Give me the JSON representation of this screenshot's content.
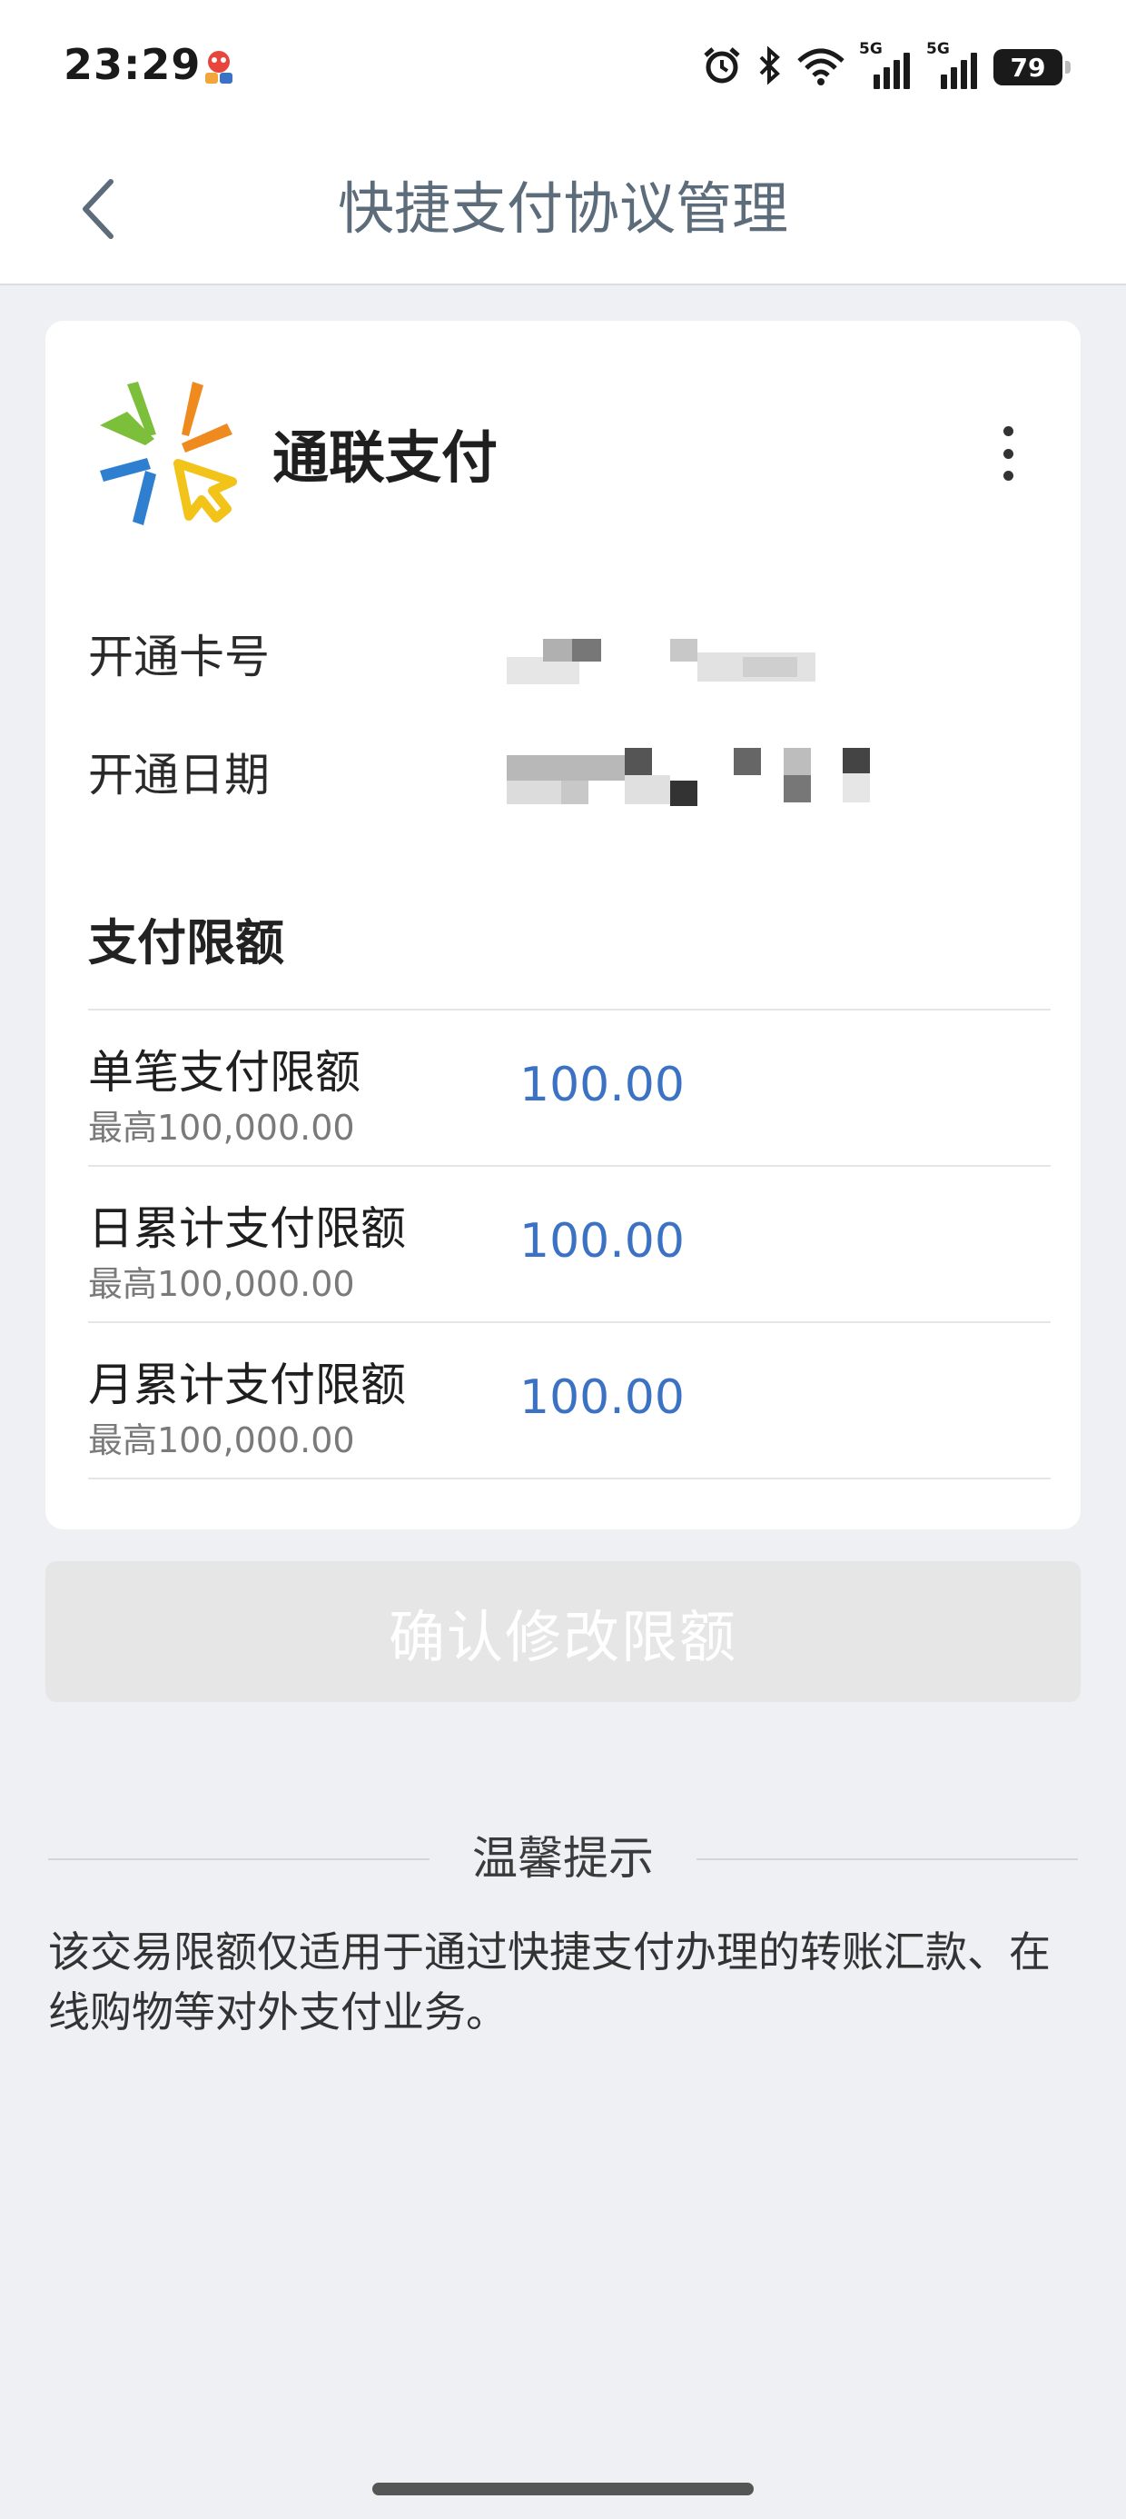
{
  "status_bar": {
    "time": "23:29",
    "network_label_1": "5G",
    "network_label_2": "5G",
    "battery": "79"
  },
  "nav": {
    "title": "快捷支付协议管理",
    "back_icon": "chevron-left-icon"
  },
  "merchant": {
    "name": "通联支付",
    "logo_icon": "allinpay-logo",
    "more_icon": "more-vertical-icon"
  },
  "info": {
    "card_label": "开通卡号",
    "date_label": "开通日期"
  },
  "limits": {
    "section_title": "支付限额",
    "rows": [
      {
        "label": "单笔支付限额",
        "hint": "最高100,000.00",
        "value": "100.00"
      },
      {
        "label": "日累计支付限额",
        "hint": "最高100,000.00",
        "value": "100.00"
      },
      {
        "label": "月累计支付限额",
        "hint": "最高100,000.00",
        "value": "100.00"
      }
    ]
  },
  "confirm_button": "确认修改限额",
  "tips": {
    "title": "温馨提示",
    "body": "该交易限额仅适用于通过快捷支付办理的转账汇款、在线购物等对外支付业务。"
  },
  "colors": {
    "accent_blue": "#3b72c4",
    "title_gray": "#5d6c7b",
    "page_bg": "#eff0f4",
    "button_disabled": "#e6e6e6"
  }
}
